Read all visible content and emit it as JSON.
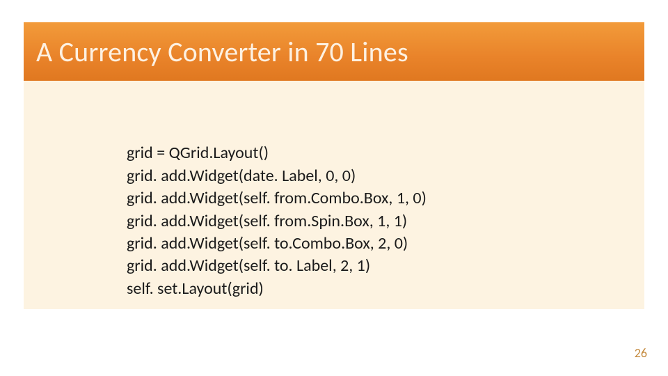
{
  "title": "A Currency Converter in 70 Lines",
  "code": {
    "l1": "grid = QGrid.Layout()",
    "l2": "grid. add.Widget(date. Label, 0, 0)",
    "l3": "grid. add.Widget(self. from.Combo.Box, 1, 0)",
    "l4": "grid. add.Widget(self. from.Spin.Box, 1, 1)",
    "l5": "grid. add.Widget(self. to.Combo.Box, 2, 0)",
    "l6": "grid. add.Widget(self. to. Label, 2, 1)",
    "l7": "self. set.Layout(grid)"
  },
  "page_number": "26"
}
